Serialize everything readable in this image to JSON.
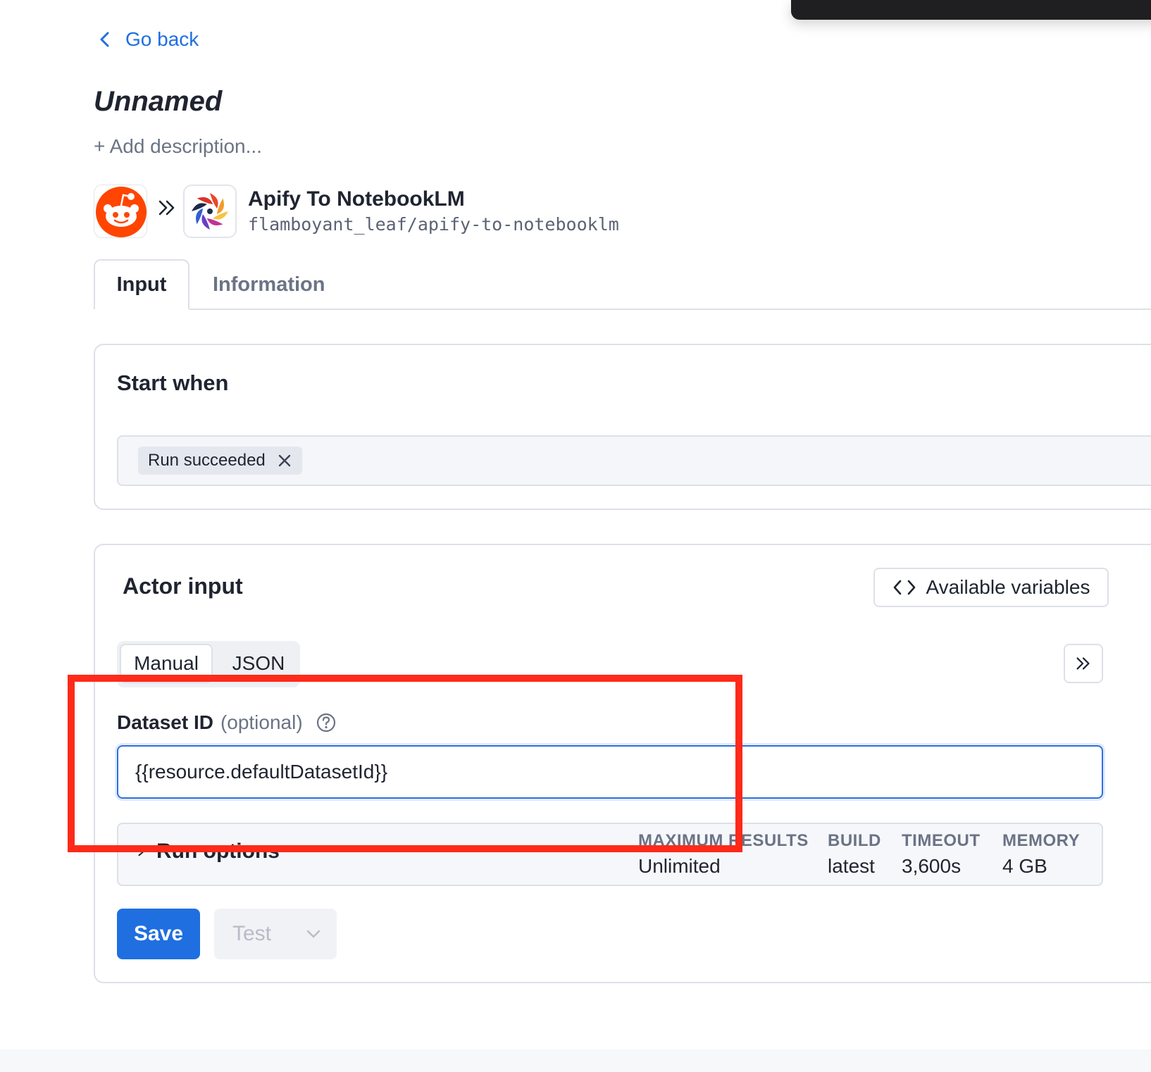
{
  "nav": {
    "back_label": "Go back"
  },
  "integration": {
    "title": "Unnamed",
    "add_description": "+ Add description...",
    "source_icon": "reddit-logo-icon",
    "target_icon": "actor-logo-icon",
    "actor_name": "Apify To NotebookLM",
    "actor_slug": "flamboyant_leaf/apify-to-notebooklm"
  },
  "tabs": [
    {
      "label": "Input",
      "active": true
    },
    {
      "label": "Information",
      "active": false
    }
  ],
  "start_when": {
    "heading": "Start when",
    "chips": [
      {
        "label": "Run succeeded"
      }
    ]
  },
  "actor_input": {
    "heading": "Actor input",
    "available_variables_label": "Available variables",
    "modes": [
      {
        "label": "Manual",
        "active": true
      },
      {
        "label": "JSON",
        "active": false
      }
    ],
    "field": {
      "label": "Dataset ID",
      "optional_label": "(optional)",
      "value": "{{resource.defaultDatasetId}}"
    },
    "run_options": {
      "label": "Run options",
      "stats": [
        {
          "key": "MAXIMUM RESULTS",
          "value": "Unlimited"
        },
        {
          "key": "BUILD",
          "value": "latest"
        },
        {
          "key": "TIMEOUT",
          "value": "3,600s"
        },
        {
          "key": "MEMORY",
          "value": "4 GB"
        }
      ]
    },
    "save_label": "Save",
    "test_label": "Test"
  },
  "colors": {
    "accent": "#1f6fe0",
    "highlight_box": "#ff2a1a",
    "reddit": "#ff4500"
  }
}
